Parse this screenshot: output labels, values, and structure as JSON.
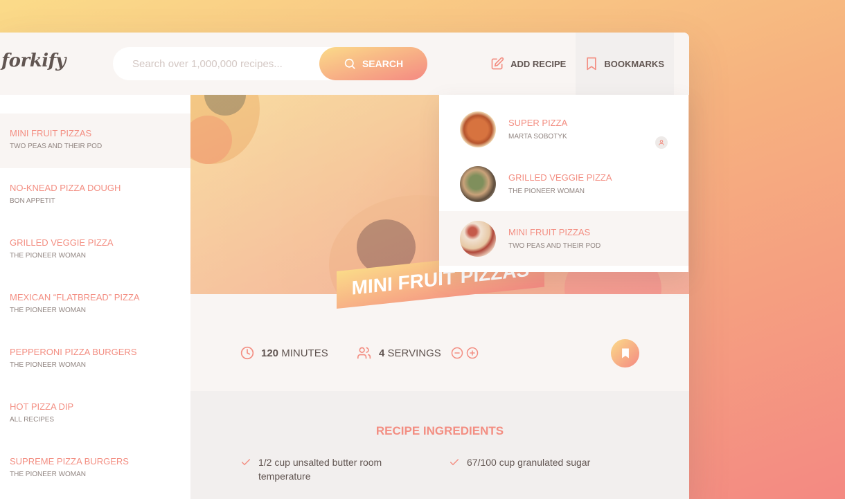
{
  "header": {
    "logo": "forkify",
    "search": {
      "placeholder": "Search over 1,000,000 recipes...",
      "button_label": "SEARCH"
    },
    "nav": {
      "add_recipe": "ADD RECIPE",
      "bookmarks": "BOOKMARKS"
    }
  },
  "results": [
    {
      "title": "MINI FRUIT PIZZAS",
      "publisher": "TWO PEAS AND THEIR POD",
      "active": true
    },
    {
      "title": "NO-KNEAD PIZZA DOUGH",
      "publisher": "BON APPETIT"
    },
    {
      "title": "GRILLED VEGGIE PIZZA",
      "publisher": "THE PIONEER WOMAN"
    },
    {
      "title": "MEXICAN “FLATBREAD” PIZZA",
      "publisher": "THE PIONEER WOMAN"
    },
    {
      "title": "PEPPERONI PIZZA BURGERS",
      "publisher": "THE PIONEER WOMAN"
    },
    {
      "title": "HOT PIZZA DIP",
      "publisher": "ALL RECIPES"
    },
    {
      "title": "SUPREME PIZZA BURGERS",
      "publisher": "THE PIONEER WOMAN"
    }
  ],
  "recipe": {
    "title": "MINI FRUIT PIZZAS",
    "minutes": "120",
    "minutes_label": "MINUTES",
    "servings": "4",
    "servings_label": "SERVINGS"
  },
  "ingredients": {
    "heading": "RECIPE INGREDIENTS",
    "items": [
      "1/2 cup unsalted butter room temperature",
      "67/100 cup granulated sugar"
    ]
  },
  "bookmarks": [
    {
      "title": "SUPER PIZZA",
      "publisher": "MARTA SOBOTYK",
      "user_generated": true
    },
    {
      "title": "GRILLED VEGGIE PIZZA",
      "publisher": "THE PIONEER WOMAN"
    },
    {
      "title": "MINI FRUIT PIZZAS",
      "publisher": "TWO PEAS AND THEIR POD",
      "active": true
    }
  ],
  "colors": {
    "accent": "#f38e82",
    "gradient_start": "#fbdb89",
    "gradient_end": "#f48982",
    "text": "#615551"
  }
}
